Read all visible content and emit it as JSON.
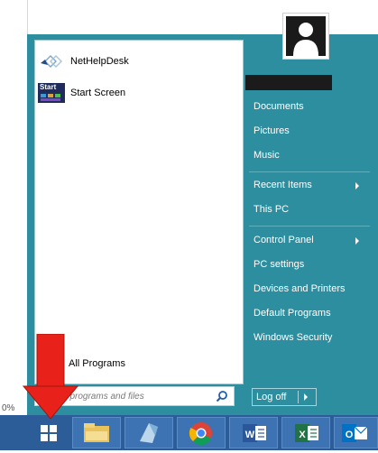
{
  "status": {
    "percent": "0%"
  },
  "programs": {
    "items": [
      {
        "label": "NetHelpDesk",
        "icon": "nethelpdesk-icon"
      },
      {
        "label": "Start Screen",
        "icon": "start-screen-icon",
        "icon_text": "Start"
      }
    ],
    "all_programs": "All Programs",
    "search_placeholder": "Search programs and files"
  },
  "right_pane": {
    "user_icon": "user-avatar-icon",
    "items": [
      {
        "label": "Documents"
      },
      {
        "label": "Pictures"
      },
      {
        "label": "Music"
      },
      {
        "label": "Recent Items",
        "submenu": true
      },
      {
        "label": "This PC"
      },
      {
        "label": "Control Panel",
        "submenu": true
      },
      {
        "label": "PC settings"
      },
      {
        "label": "Devices and Printers"
      },
      {
        "label": "Default Programs"
      },
      {
        "label": "Windows Security"
      }
    ],
    "logoff_label": "Log off"
  },
  "taskbar": {
    "items": [
      {
        "name": "start-button",
        "icon": "windows-icon"
      },
      {
        "name": "file-explorer",
        "icon": "folder-icon"
      },
      {
        "name": "app-launcher",
        "icon": "app-icon"
      },
      {
        "name": "chrome",
        "icon": "chrome-icon"
      },
      {
        "name": "word",
        "icon": "word-icon",
        "letter": "W"
      },
      {
        "name": "excel",
        "icon": "excel-icon",
        "letter": "X"
      },
      {
        "name": "outlook",
        "icon": "outlook-icon",
        "letter": "O"
      }
    ]
  },
  "colors": {
    "menu_bg": "#2d8ea0",
    "taskbar_bg": "#2c5d99",
    "annotation_arrow": "#e8211a"
  }
}
